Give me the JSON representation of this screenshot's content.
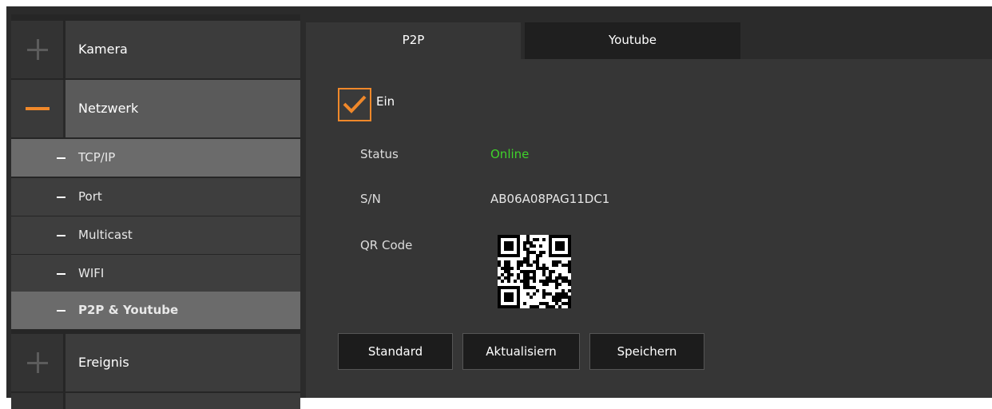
{
  "sidebar": {
    "categories": [
      {
        "label": "Kamera"
      },
      {
        "label": "Netzwerk"
      },
      {
        "label": "Ereignis"
      }
    ],
    "network_items": [
      {
        "label": "TCP/IP"
      },
      {
        "label": "Port"
      },
      {
        "label": "Multicast"
      },
      {
        "label": "WIFI"
      },
      {
        "label": "P2P & Youtube"
      }
    ]
  },
  "tabs": [
    {
      "label": "P2P"
    },
    {
      "label": "Youtube"
    }
  ],
  "p2p": {
    "enable_label": "Ein",
    "enabled": true,
    "status_label": "Status",
    "status_value": "Online",
    "serial_label": "S/N",
    "serial_value": "AB06A08PAG11DC1",
    "qr_label": "QR Code"
  },
  "buttons": {
    "default": "Standard",
    "refresh": "Aktualisiern",
    "save": "Speichern"
  },
  "colors": {
    "accent": "#f0882a",
    "online": "#3fd22a"
  }
}
